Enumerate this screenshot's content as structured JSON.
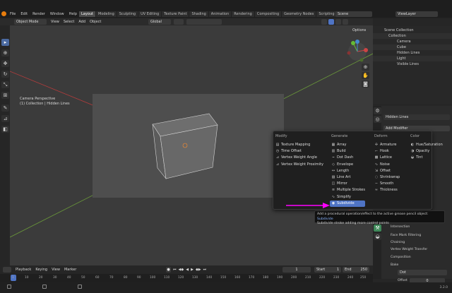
{
  "topbar": {
    "menus": [
      "File",
      "Edit",
      "Render",
      "Window",
      "Help"
    ],
    "workspaces": [
      "Layout",
      "Modeling",
      "Sculpting",
      "UV Editing",
      "Texture Paint",
      "Shading",
      "Animation",
      "Rendering",
      "Compositing",
      "Geometry Nodes",
      "Scripting"
    ],
    "active_workspace": "Layout",
    "scene": "Scene",
    "view_layer": "ViewLayer"
  },
  "viewport_header": {
    "mode": "Object Mode",
    "menus": [
      "View",
      "Select",
      "Add",
      "Object"
    ],
    "orientation": "Global",
    "options": "Options"
  },
  "viewport": {
    "camera_label": "Camera Perspective",
    "collection_label": "(1) Collection | Hidden Lines"
  },
  "outliner": {
    "title": "Scene Collection",
    "items": [
      {
        "label": "Collection",
        "indent": 1,
        "icon": "collection-icon"
      },
      {
        "label": "Camera",
        "indent": 2,
        "icon": "camera-icon"
      },
      {
        "label": "Cube",
        "indent": 2,
        "icon": "mesh-icon"
      },
      {
        "label": "Hidden Lines",
        "indent": 2,
        "icon": "gpencil-icon"
      },
      {
        "label": "Light",
        "indent": 2,
        "icon": "light-icon"
      },
      {
        "label": "Visible Lines",
        "indent": 2,
        "icon": "gpencil-icon"
      }
    ]
  },
  "properties": {
    "object_name": "Hidden Lines",
    "add_modifier": "Add Modifier",
    "panels": [
      "Intersection",
      "Face Mark Filtering",
      "Chaining",
      "Vertex Weight Transfer",
      "Composition",
      "Bake"
    ],
    "dot_label": "Dot",
    "offset_label": "Offset",
    "offset_value": "0"
  },
  "modifier_menu": {
    "columns": [
      {
        "title": "Modify",
        "items": [
          {
            "label": "Texture Mapping",
            "icon": "▤"
          },
          {
            "label": "Time Offset",
            "icon": "◷"
          },
          {
            "label": "Vertex Weight Angle",
            "icon": "⊿"
          },
          {
            "label": "Vertex Weight Proximity",
            "icon": "⊿"
          }
        ]
      },
      {
        "title": "Generate",
        "items": [
          {
            "label": "Array",
            "icon": "▦"
          },
          {
            "label": "Build",
            "icon": "▥"
          },
          {
            "label": "Dot Dash",
            "icon": "┅"
          },
          {
            "label": "Envelope",
            "icon": "◇"
          },
          {
            "label": "Length",
            "icon": "↔"
          },
          {
            "label": "Line Art",
            "icon": "▨"
          },
          {
            "label": "Mirror",
            "icon": "◫"
          },
          {
            "label": "Multiple Strokes",
            "icon": "≡"
          },
          {
            "label": "Simplify",
            "icon": "∿"
          },
          {
            "label": "Subdivide",
            "icon": "◉"
          }
        ]
      },
      {
        "title": "Deform",
        "items": [
          {
            "label": "Armature",
            "icon": "✢"
          },
          {
            "label": "Hook",
            "icon": "⌐"
          },
          {
            "label": "Lattice",
            "icon": "▩"
          },
          {
            "label": "Noise",
            "icon": "∿"
          },
          {
            "label": "Offset",
            "icon": "⇲"
          },
          {
            "label": "Shrinkwrap",
            "icon": "◌"
          },
          {
            "label": "Smooth",
            "icon": "∼"
          },
          {
            "label": "Thickness",
            "icon": "≈"
          }
        ]
      },
      {
        "title": "Color",
        "items": [
          {
            "label": "Hue/Saturation",
            "icon": "◐"
          },
          {
            "label": "Opacity",
            "icon": "◑"
          },
          {
            "label": "Tint",
            "icon": "◒"
          }
        ]
      }
    ],
    "highlighted": "Subdivide"
  },
  "tooltip": {
    "prefix": "Add a procedural operation/effect to the active grease pencil object:",
    "name": "Subdivide",
    "desc": "Subdivide stroke adding more control points"
  },
  "timeline": {
    "menus": [
      "Playback",
      "Keying",
      "View",
      "Marker"
    ],
    "current_frame": "1",
    "start_label": "Start",
    "start": "1",
    "end_label": "End",
    "end": "250",
    "ruler": [
      "1",
      "10",
      "20",
      "30",
      "40",
      "50",
      "60",
      "70",
      "80",
      "90",
      "100",
      "110",
      "120",
      "130",
      "140",
      "150",
      "160",
      "170",
      "180",
      "190",
      "200",
      "210",
      "220",
      "230",
      "240",
      "250"
    ]
  },
  "status": {
    "version": "3.2.0"
  },
  "colors": {
    "accent": "#4f74c5",
    "arrow": "#ff00ff",
    "x_axis": "#b43c3c",
    "y_axis": "#6b9a3a"
  }
}
